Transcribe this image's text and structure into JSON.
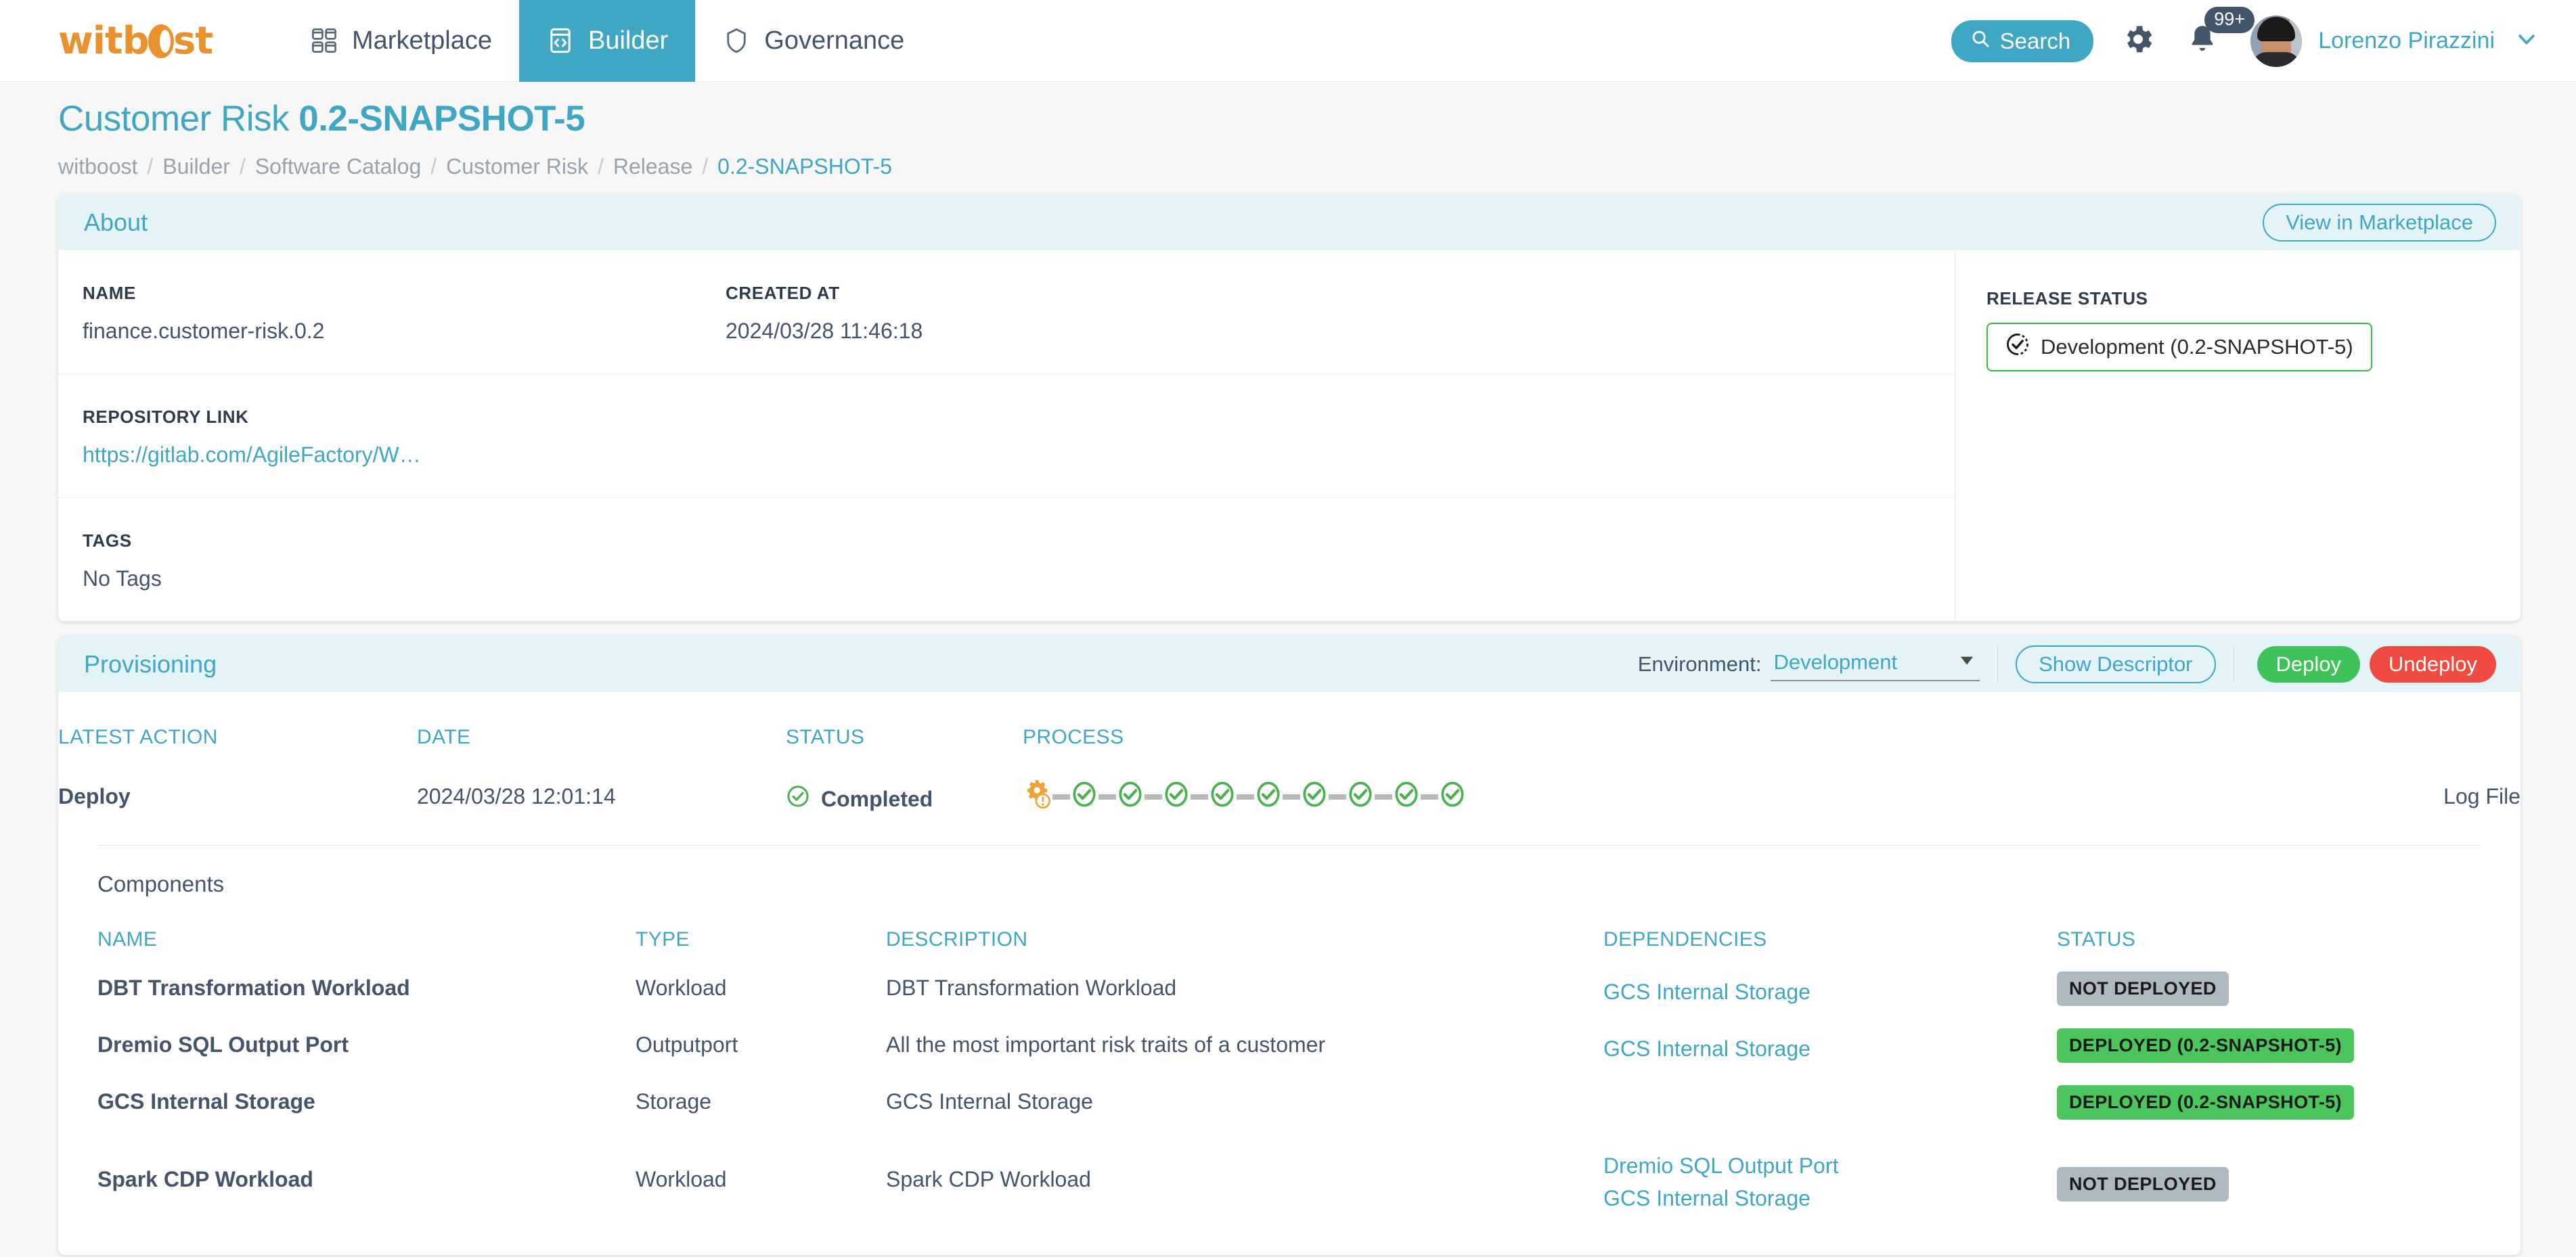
{
  "nav": {
    "logo_text": "witboost",
    "tabs": [
      {
        "label": "Marketplace",
        "icon": "grid-icon",
        "active": false
      },
      {
        "label": "Builder",
        "icon": "code-window-icon",
        "active": true
      },
      {
        "label": "Governance",
        "icon": "shield-icon",
        "active": false
      }
    ],
    "search_label": "Search",
    "notification_count": "99+",
    "username": "Lorenzo Pirazzini"
  },
  "page": {
    "title_prefix": "Customer Risk ",
    "title_version": "0.2-SNAPSHOT-5",
    "breadcrumb": [
      "witboost",
      "Builder",
      "Software Catalog",
      "Customer Risk",
      "Release",
      "0.2-SNAPSHOT-5"
    ]
  },
  "about": {
    "heading": "About",
    "view_marketplace_label": "View in Marketplace",
    "name_label": "NAME",
    "name_value": "finance.customer-risk.0.2",
    "created_label": "CREATED AT",
    "created_value": "2024/03/28 11:46:18",
    "repo_label": "REPOSITORY LINK",
    "repo_value": "https://gitlab.com/AgileFactory/W…",
    "tags_label": "TAGS",
    "tags_value": "No Tags",
    "release_status_label": "RELEASE STATUS",
    "release_status_value": "Development (0.2-SNAPSHOT-5)"
  },
  "provisioning": {
    "heading": "Provisioning",
    "environment_label": "Environment:",
    "environment_value": "Development",
    "show_descriptor_label": "Show Descriptor",
    "deploy_label": "Deploy",
    "undeploy_label": "Undeploy",
    "headers": {
      "latest_action": "LATEST ACTION",
      "date": "DATE",
      "status": "STATUS",
      "process": "PROCESS"
    },
    "latest": {
      "action": "Deploy",
      "date": "2024/03/28 12:01:14",
      "status": "Completed",
      "process_steps": [
        "gear-warning",
        "check",
        "check",
        "check",
        "check",
        "check",
        "check",
        "check",
        "check",
        "check"
      ],
      "log_file_label": "Log File"
    },
    "components_title": "Components",
    "component_headers": [
      "NAME",
      "TYPE",
      "DESCRIPTION",
      "DEPENDENCIES",
      "STATUS"
    ],
    "components": [
      {
        "name": "DBT Transformation Workload",
        "type": "Workload",
        "description": "DBT Transformation Workload",
        "dependencies": [
          "GCS Internal Storage"
        ],
        "status": "NOT DEPLOYED",
        "status_kind": "grey"
      },
      {
        "name": "Dremio SQL Output Port",
        "type": "Outputport",
        "description": "All the most important risk traits of a customer",
        "dependencies": [
          "GCS Internal Storage"
        ],
        "status": "DEPLOYED (0.2-SNAPSHOT-5)",
        "status_kind": "green"
      },
      {
        "name": "GCS Internal Storage",
        "type": "Storage",
        "description": "GCS Internal Storage",
        "dependencies": [],
        "status": "DEPLOYED (0.2-SNAPSHOT-5)",
        "status_kind": "green"
      },
      {
        "name": "Spark CDP Workload",
        "type": "Workload",
        "description": "Spark CDP Workload",
        "dependencies": [
          "Dremio SQL Output Port",
          "GCS Internal Storage"
        ],
        "status": "NOT DEPLOYED",
        "status_kind": "grey"
      }
    ]
  },
  "colors": {
    "brand_teal": "#3FA7C4",
    "brand_orange": "#E8912D",
    "deploy_green": "#3FC25A",
    "undeploy_red": "#F04B43",
    "badge_grey": "#AEBAC2",
    "badge_green": "#4CC55F",
    "card_head": "#E3F3F7",
    "text_slate": "#44546A"
  }
}
